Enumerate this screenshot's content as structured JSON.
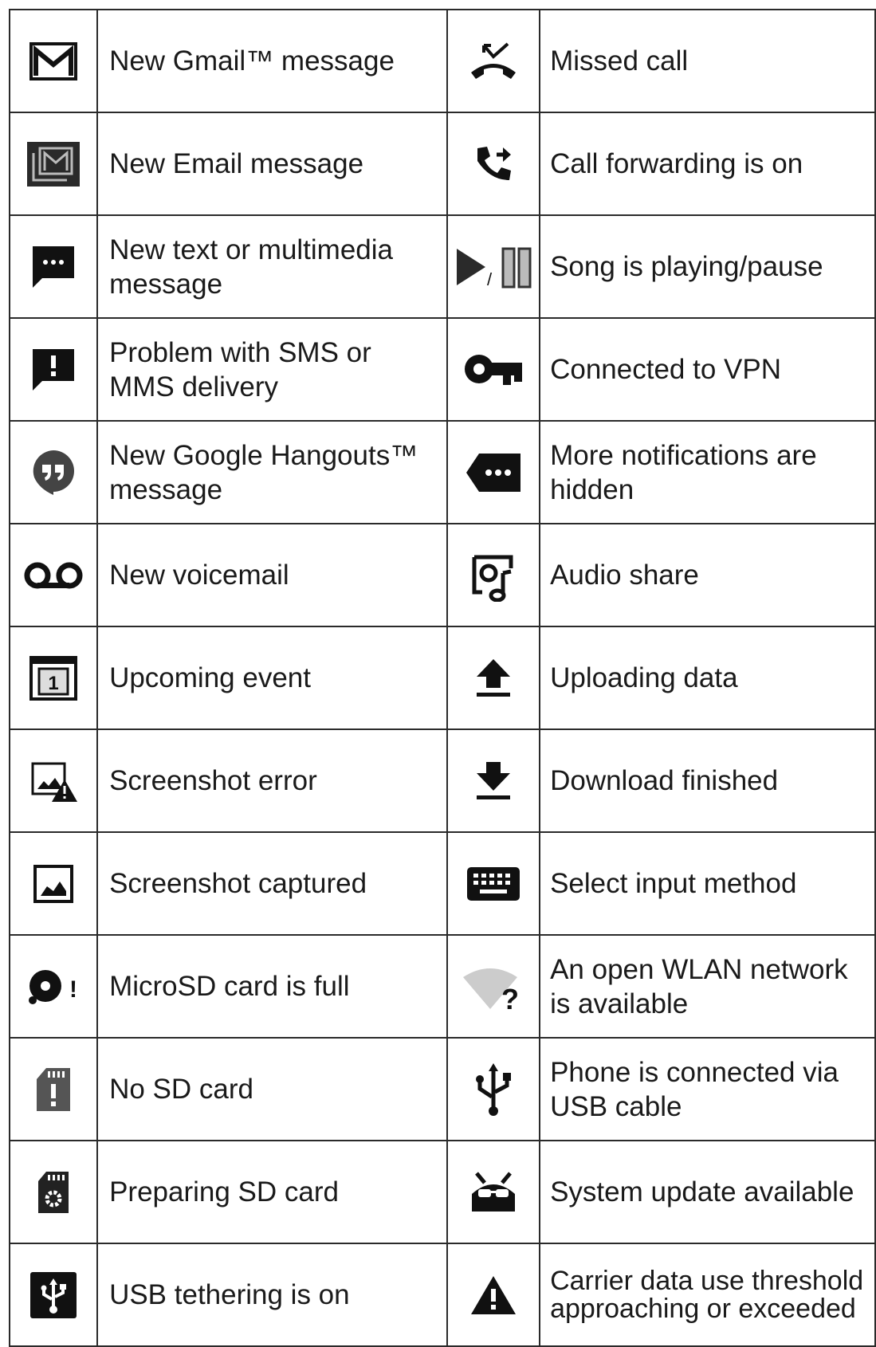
{
  "rows": [
    {
      "left": {
        "icon": "gmail-icon",
        "label": "New Gmail™  message"
      },
      "right": {
        "icon": "missed-call-icon",
        "label": "Missed call"
      }
    },
    {
      "left": {
        "icon": "email-icon",
        "label": "New Email message"
      },
      "right": {
        "icon": "call-forward-icon",
        "label": "Call forwarding is on"
      }
    },
    {
      "left": {
        "icon": "sms-icon",
        "label": "New text or multimedia message"
      },
      "right": {
        "icon": "play-pause-icon",
        "label": "Song is playing/pause",
        "slash": "/"
      }
    },
    {
      "left": {
        "icon": "sms-error-icon",
        "label": "Problem with SMS or MMS delivery"
      },
      "right": {
        "icon": "vpn-key-icon",
        "label": "Connected to VPN"
      }
    },
    {
      "left": {
        "icon": "hangouts-icon",
        "label": "New Google Hangouts™ message"
      },
      "right": {
        "icon": "more-notifications-icon",
        "label": "More notifications are hidden"
      }
    },
    {
      "left": {
        "icon": "voicemail-icon",
        "label": "New voicemail"
      },
      "right": {
        "icon": "audio-share-icon",
        "label": "Audio share"
      }
    },
    {
      "left": {
        "icon": "calendar-icon",
        "label": "Upcoming event",
        "day": "1"
      },
      "right": {
        "icon": "upload-icon",
        "label": "Uploading data"
      }
    },
    {
      "left": {
        "icon": "screenshot-error-icon",
        "label": "Screenshot error"
      },
      "right": {
        "icon": "download-icon",
        "label": "Download finished"
      }
    },
    {
      "left": {
        "icon": "screenshot-icon",
        "label": " Screenshot captured"
      },
      "right": {
        "icon": "keyboard-icon",
        "label": "Select input method"
      }
    },
    {
      "left": {
        "icon": "sd-full-icon",
        "label": "MicroSD card is full",
        "mark": "!"
      },
      "right": {
        "icon": "open-wifi-icon",
        "label": "An open WLAN network is available",
        "mark": "?"
      }
    },
    {
      "left": {
        "icon": "no-sd-icon",
        "label": "No SD card"
      },
      "right": {
        "icon": "usb-icon",
        "label": "Phone is connected via USB cable"
      }
    },
    {
      "left": {
        "icon": "sd-preparing-icon",
        "label": "Preparing SD card"
      },
      "right": {
        "icon": "system-update-icon",
        "label": "System update available"
      }
    },
    {
      "left": {
        "icon": "usb-tethering-icon",
        "label": "USB tethering is on"
      },
      "right": {
        "icon": "warning-icon",
        "label": "Carrier data use threshold approaching or exceeded"
      }
    }
  ]
}
